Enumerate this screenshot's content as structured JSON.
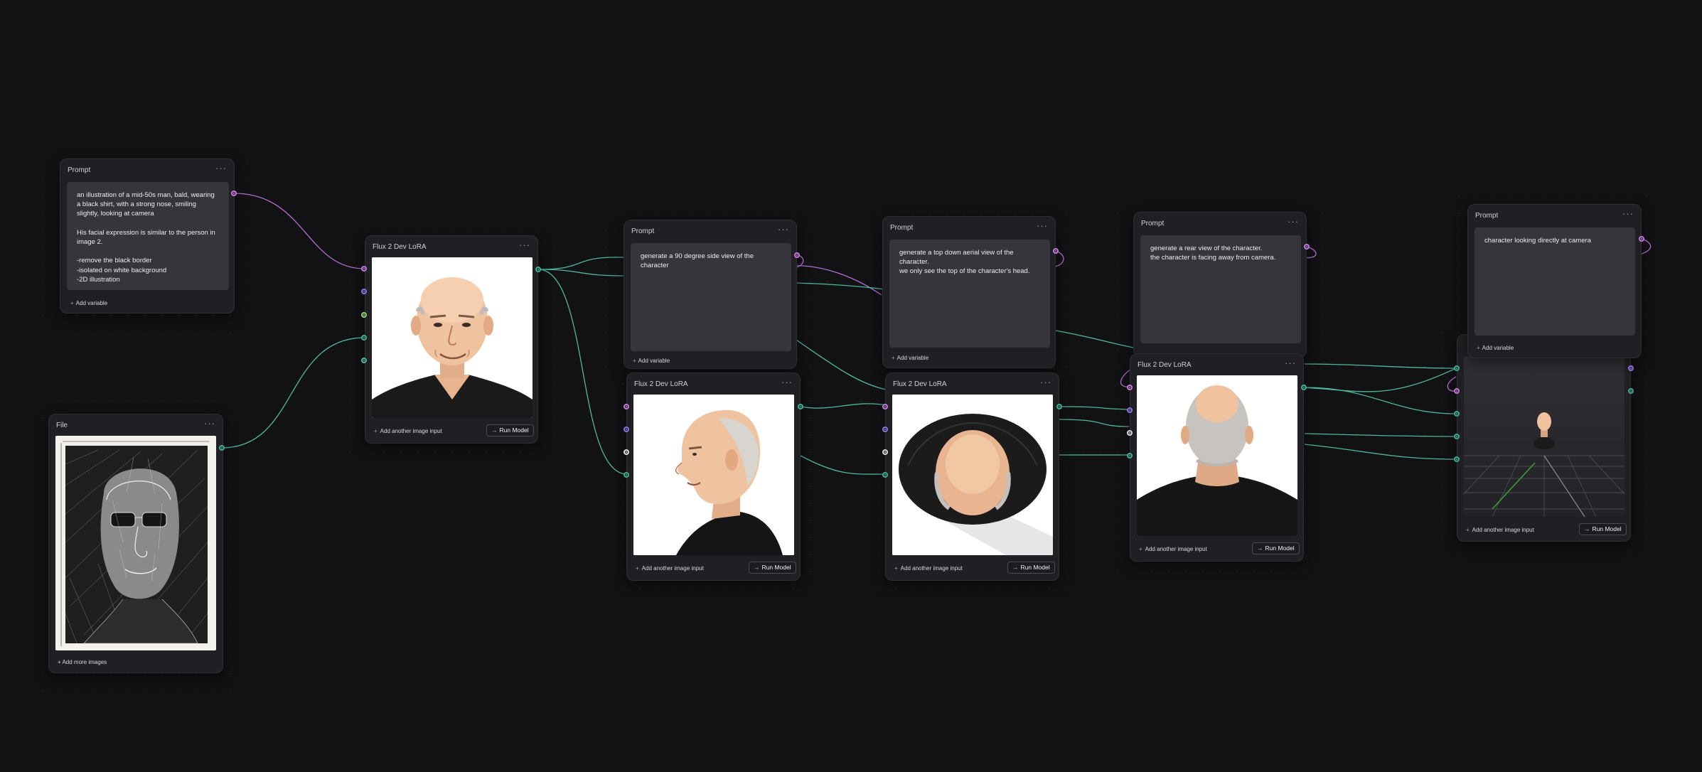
{
  "prompt_nodes": [
    {
      "title": "Prompt",
      "menu": "···",
      "text": "an illustration of a mid-50s man, bald, wearing a black shirt, with a strong nose, smiling slightly, looking at camera\n\nHis facial expression is similar to the person in image 2.\n\n-remove the black border\n-isolated on white background\n-2D illustration",
      "add_variable": "Add variable"
    },
    {
      "title": "Prompt",
      "menu": "···",
      "text": "generate a 90 degree side view of the character",
      "add_variable": "Add variable"
    },
    {
      "title": "Prompt",
      "menu": "···",
      "text": "generate a top down aerial view of the character.\nwe only see the top of the character's head.",
      "add_variable": "Add variable"
    },
    {
      "title": "Prompt",
      "menu": "···",
      "text": "generate a rear view of the character.\nthe character is facing away from camera.",
      "add_variable": ""
    },
    {
      "title": "Prompt",
      "menu": "···",
      "text": "character looking directly at camera",
      "add_variable": "Add variable"
    }
  ],
  "model_nodes": [
    {
      "title": "Flux 2 Dev LoRA",
      "menu": "···",
      "image": "front-portrait",
      "add_input": "Add another image input",
      "run": "Run Model"
    },
    {
      "title": "Flux 2 Dev LoRA",
      "menu": "···",
      "image": "side-profile",
      "add_input": "Add another image input",
      "run": "Run Model"
    },
    {
      "title": "Flux 2 Dev LoRA",
      "menu": "···",
      "image": "top-down-view",
      "add_input": "Add another image input",
      "run": "Run Model"
    },
    {
      "title": "Flux 2 Dev LoRA",
      "menu": "···",
      "image": "rear-view",
      "add_input": "Add another image input",
      "run": "Run Model"
    },
    {
      "title": "",
      "menu": "",
      "image": "3d-viewport",
      "add_input": "Add another image input",
      "run": "Run Model"
    }
  ],
  "file_node": {
    "title": "File",
    "menu": "···",
    "image": "pencil-sketch-portrait",
    "add_images": "+ Add more images"
  },
  "colors": {
    "canvas": "#121215",
    "node": "#202024",
    "textarea": "#35353b",
    "wire_text": "#c07ad9",
    "wire_image": "#4fb89c",
    "port_purple": "#8b73e0",
    "port_lime": "#8fd37a"
  }
}
